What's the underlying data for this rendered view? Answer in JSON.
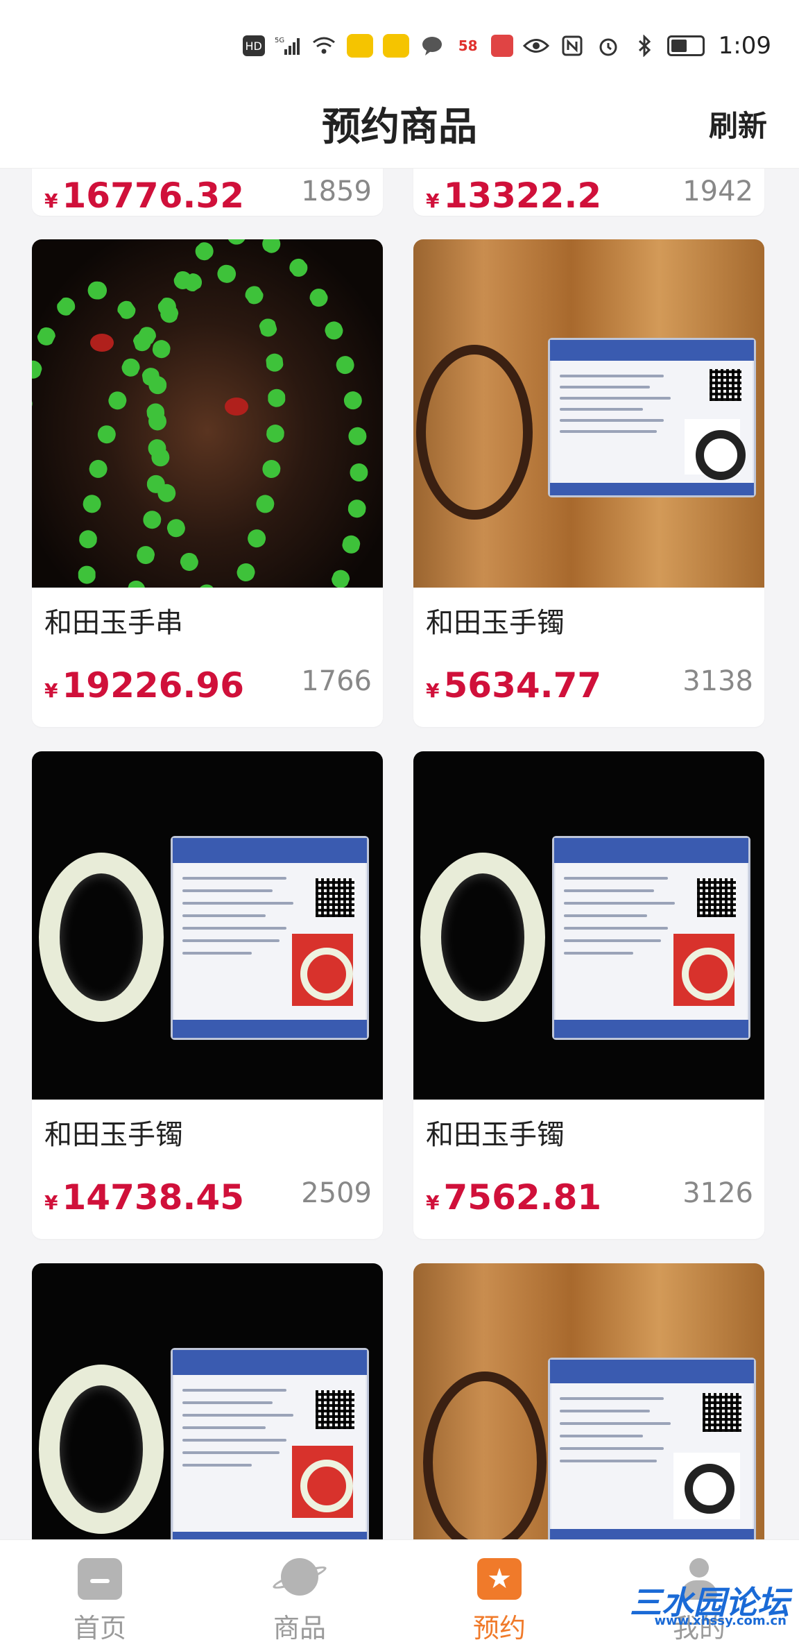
{
  "status_bar": {
    "network": "HD",
    "signal": "5G",
    "badge_58": "58",
    "time": "1:09"
  },
  "header": {
    "title": "预约商品",
    "refresh_label": "刷新"
  },
  "products": [
    {
      "name": "",
      "price": "16776.32",
      "count": "1859",
      "image": "partial-top"
    },
    {
      "name": "",
      "price": "13322.2",
      "count": "1942",
      "image": "partial-top"
    },
    {
      "name": "和田玉手串",
      "price": "19226.96",
      "count": "1766",
      "image": "green-jade-bead-strand"
    },
    {
      "name": "和田玉手镯",
      "price": "5634.77",
      "count": "3138",
      "image": "dark-bangle-with-certificate"
    },
    {
      "name": "和田玉手镯",
      "price": "14738.45",
      "count": "2509",
      "image": "white-bangle-with-certificate"
    },
    {
      "name": "和田玉手镯",
      "price": "7562.81",
      "count": "3126",
      "image": "white-bangle-with-certificate"
    },
    {
      "name": "",
      "price": "",
      "count": "",
      "image": "white-bangle-with-certificate"
    },
    {
      "name": "",
      "price": "",
      "count": "",
      "image": "dark-bangle-with-certificate"
    }
  ],
  "currency_symbol": "¥",
  "tabbar": {
    "tabs": [
      {
        "label": "首页",
        "icon": "home-icon",
        "active": false
      },
      {
        "label": "商品",
        "icon": "planet-icon",
        "active": false
      },
      {
        "label": "预约",
        "icon": "star-bookmark-icon",
        "active": true
      },
      {
        "label": "我的",
        "icon": "user-icon",
        "active": false
      }
    ]
  },
  "watermark": {
    "site_name": "三水园论坛",
    "url": "www.xhssy.com.cn"
  },
  "colors": {
    "price": "#d0103a",
    "accent": "#f07a2a",
    "inactive_tab": "#9a9a9a"
  }
}
